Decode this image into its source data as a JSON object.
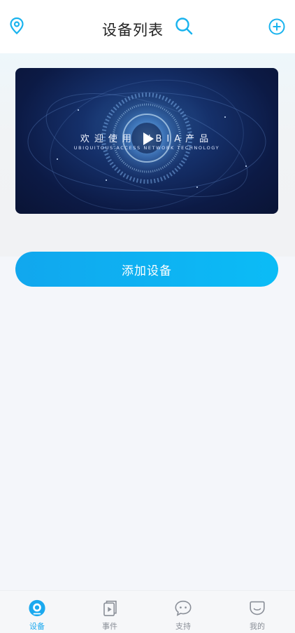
{
  "header": {
    "title": "设备列表"
  },
  "banner": {
    "headline": "欢迎使用 UBIA产品",
    "subline": "UBIQUITOUS ACCESS NETWORK TECHNOLOGY"
  },
  "actions": {
    "add_device": "添加设备"
  },
  "tabs": [
    {
      "label": "设备",
      "icon": "camera-icon",
      "active": true
    },
    {
      "label": "事件",
      "icon": "event-video-icon",
      "active": false
    },
    {
      "label": "支持",
      "icon": "chat-icon",
      "active": false
    },
    {
      "label": "我的",
      "icon": "profile-icon",
      "active": false
    }
  ],
  "colors": {
    "accent": "#1ba9ef",
    "button_start": "#11a7ee",
    "button_end": "#0bbcf6",
    "banner_dark": "#0c1a45"
  }
}
